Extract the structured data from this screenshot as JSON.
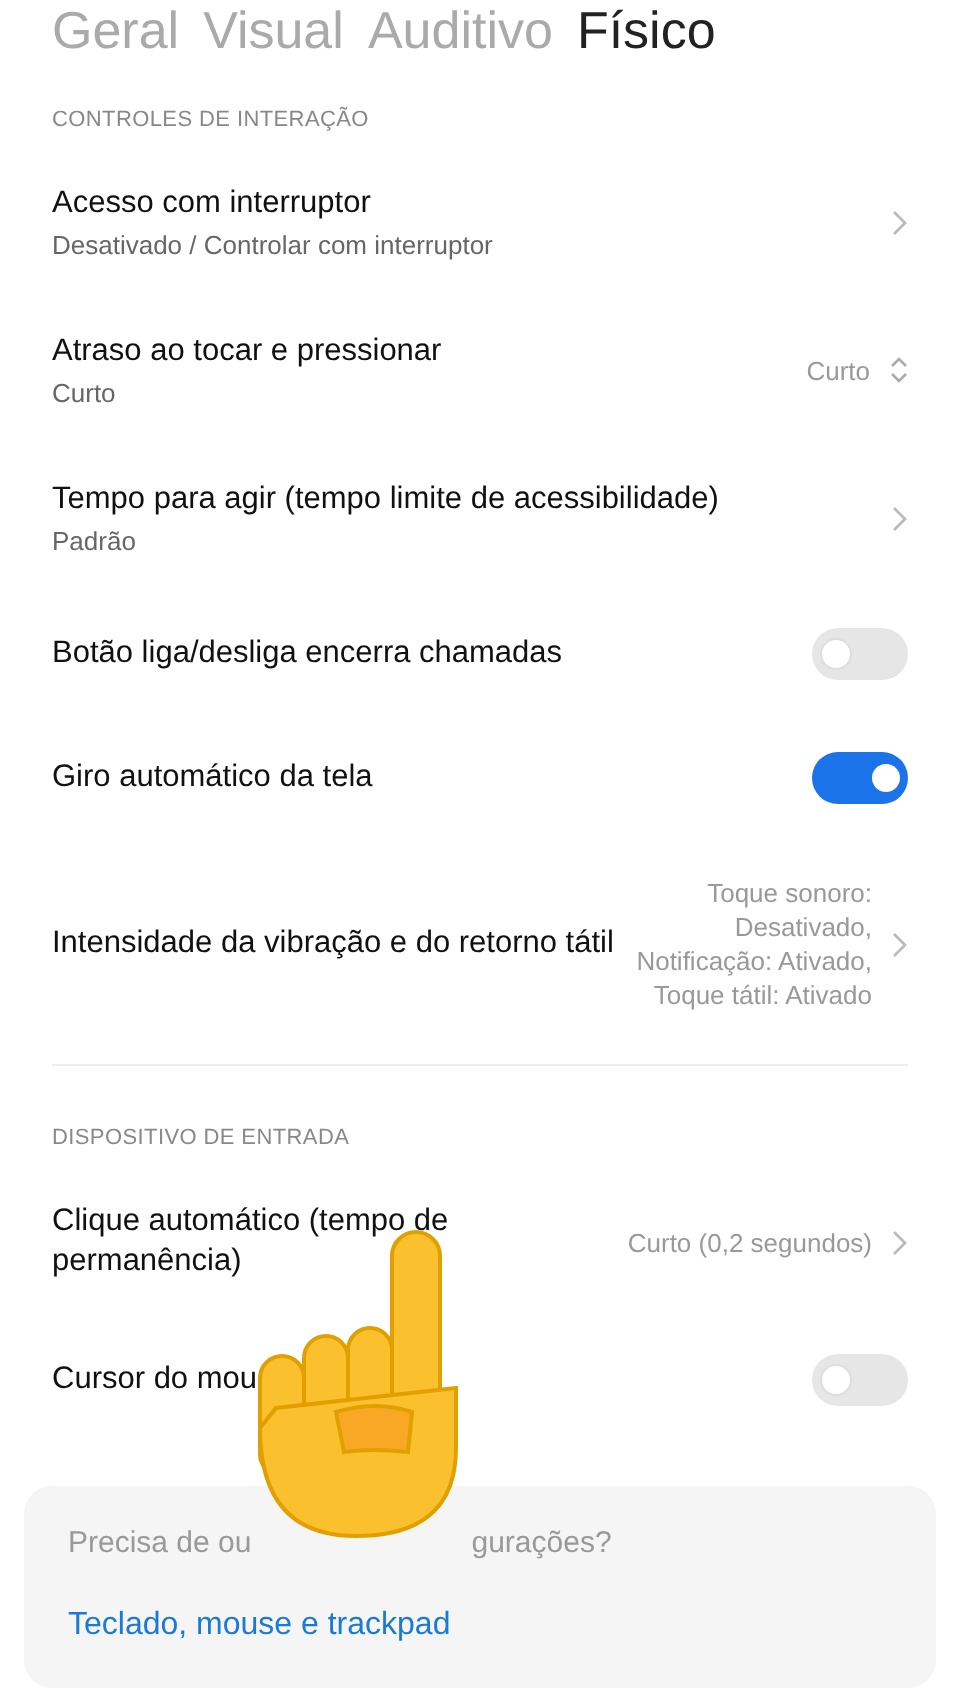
{
  "tabs": [
    {
      "label": "Geral",
      "selected": false
    },
    {
      "label": "Visual",
      "selected": false
    },
    {
      "label": "Auditivo",
      "selected": false
    },
    {
      "label": "Físico",
      "selected": true
    }
  ],
  "sections": [
    {
      "header": "CONTROLES DE INTERAÇÃO",
      "items": [
        {
          "kind": "chevron",
          "title": "Acesso com interruptor",
          "subtitle": "Desativado / Controlar com interruptor"
        },
        {
          "kind": "select",
          "title": "Atraso ao tocar e pressionar",
          "subtitle": "Curto",
          "value": "Curto"
        },
        {
          "kind": "chevron",
          "title": "Tempo para agir (tempo limite de acessibilidade)",
          "subtitle": "Padrão"
        },
        {
          "kind": "toggle",
          "title": "Botão liga/desliga encerra chamadas",
          "on": false
        },
        {
          "kind": "toggle",
          "title": "Giro automático da tela",
          "on": true
        },
        {
          "kind": "chevron",
          "title": "Intensidade da vibração e do retorno tátil",
          "value_lines": [
            "Toque sonoro:",
            "Desativado,",
            "Notificação: Ativado,",
            "Toque tátil: Ativado"
          ]
        }
      ]
    },
    {
      "header": "DISPOSITIVO DE ENTRADA",
      "items": [
        {
          "kind": "chevron",
          "title": "Clique automático (tempo de permanência)",
          "value_lines": [
            "Curto (0,2 segundos)"
          ]
        },
        {
          "kind": "toggle",
          "title": "Cursor do mou",
          "on": false
        }
      ]
    }
  ],
  "more_card": {
    "question_parts": [
      "Precisa de ou",
      "gurações?"
    ],
    "link": "Teclado, mouse e trackpad"
  }
}
